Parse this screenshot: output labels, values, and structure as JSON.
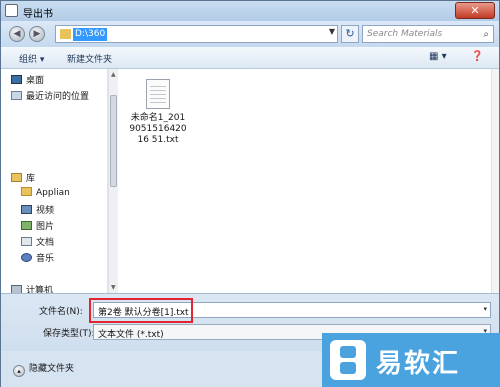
{
  "window": {
    "title": "导出书",
    "close_glyph": "✕"
  },
  "address_bar": {
    "back_glyph": "◀",
    "forward_glyph": "▶",
    "path": "D:\\360",
    "dropdown_glyph": "▼",
    "refresh_glyph": "↻",
    "search_placeholder": "Search Materials",
    "search_glyph": "⌕"
  },
  "toolbar": {
    "organize": "组织 ▾",
    "new_folder": "新建文件夹",
    "view_glyph": "▦ ▾",
    "help_glyph": "❓"
  },
  "nav": {
    "items": [
      {
        "label": "桌面",
        "icon": "desktop-icon"
      },
      {
        "label": "最近访问的位置",
        "icon": "recent-places-icon"
      },
      {
        "label": "库",
        "icon": "library-icon"
      },
      {
        "label": "Applian",
        "icon": "folder-icon"
      },
      {
        "label": "视频",
        "icon": "video-icon"
      },
      {
        "label": "图片",
        "icon": "picture-icon"
      },
      {
        "label": "文档",
        "icon": "document-icon"
      },
      {
        "label": "音乐",
        "icon": "music-icon"
      },
      {
        "label": "计算机",
        "icon": "computer-icon"
      }
    ]
  },
  "files": [
    {
      "name": "未命名1_201905151642016 51.txt",
      "display": "未命名\n1_2019051\n51642016\n51.txt",
      "icon": "text-file-icon"
    }
  ],
  "form": {
    "filename_label": "文件名(N):",
    "filename_value": "第2卷 默认分卷[1].txt",
    "filetype_label": "保存类型(T):",
    "filetype_value": "文本文件 (*.txt)",
    "dropdown_glyph": "▾"
  },
  "footer": {
    "hide_folders": "隐藏文件夹",
    "hide_glyph": "▴"
  },
  "watermark": {
    "text": "易软汇"
  },
  "colors": {
    "highlight": "#e3252f",
    "watermark_bg": "#4aa3df",
    "selection": "#3399ff"
  }
}
